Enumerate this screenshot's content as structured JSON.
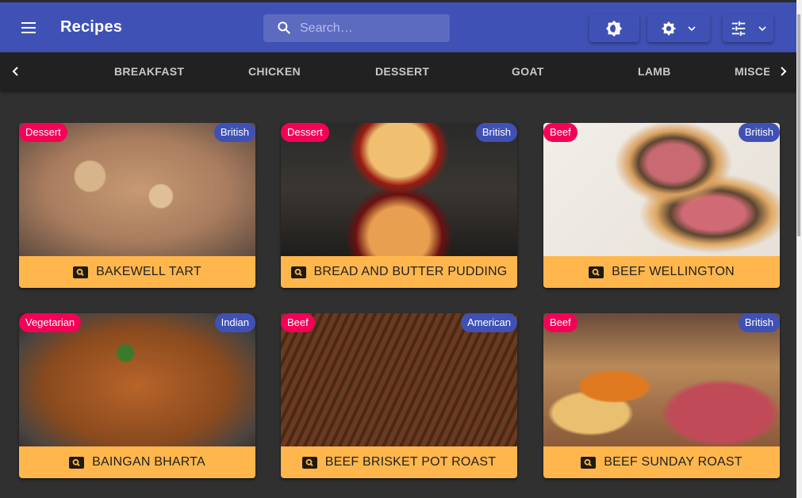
{
  "appbar": {
    "title": "Recipes",
    "search_placeholder": "Search…",
    "search_value": "",
    "buttons": [
      {
        "name": "theme-toggle",
        "icon": "brightness-icon"
      },
      {
        "name": "settings",
        "icon": "gear-icon",
        "dropdown": true
      },
      {
        "name": "filters",
        "icon": "tune-icon",
        "dropdown": true
      }
    ]
  },
  "tabs": {
    "items": [
      "BREAKFAST",
      "CHICKEN",
      "DESSERT",
      "GOAT",
      "LAMB",
      "MISCE"
    ],
    "prev_icon": "chevron-left-icon",
    "next_icon": "chevron-right-icon"
  },
  "colors": {
    "primary": "#3f51b5",
    "accent": "#f50057",
    "card_footer": "#ffb74d",
    "background": "#303030"
  },
  "recipes": [
    {
      "title": "BAKEWELL TART",
      "category": "Dessert",
      "area": "British"
    },
    {
      "title": "BREAD AND BUTTER PUDDING",
      "category": "Dessert",
      "area": "British"
    },
    {
      "title": "BEEF WELLINGTON",
      "category": "Beef",
      "area": "British"
    },
    {
      "title": "BAINGAN BHARTA",
      "category": "Vegetarian",
      "area": "Indian"
    },
    {
      "title": "BEEF BRISKET POT ROAST",
      "category": "Beef",
      "area": "American"
    },
    {
      "title": "BEEF SUNDAY ROAST",
      "category": "Beef",
      "area": "British"
    }
  ]
}
